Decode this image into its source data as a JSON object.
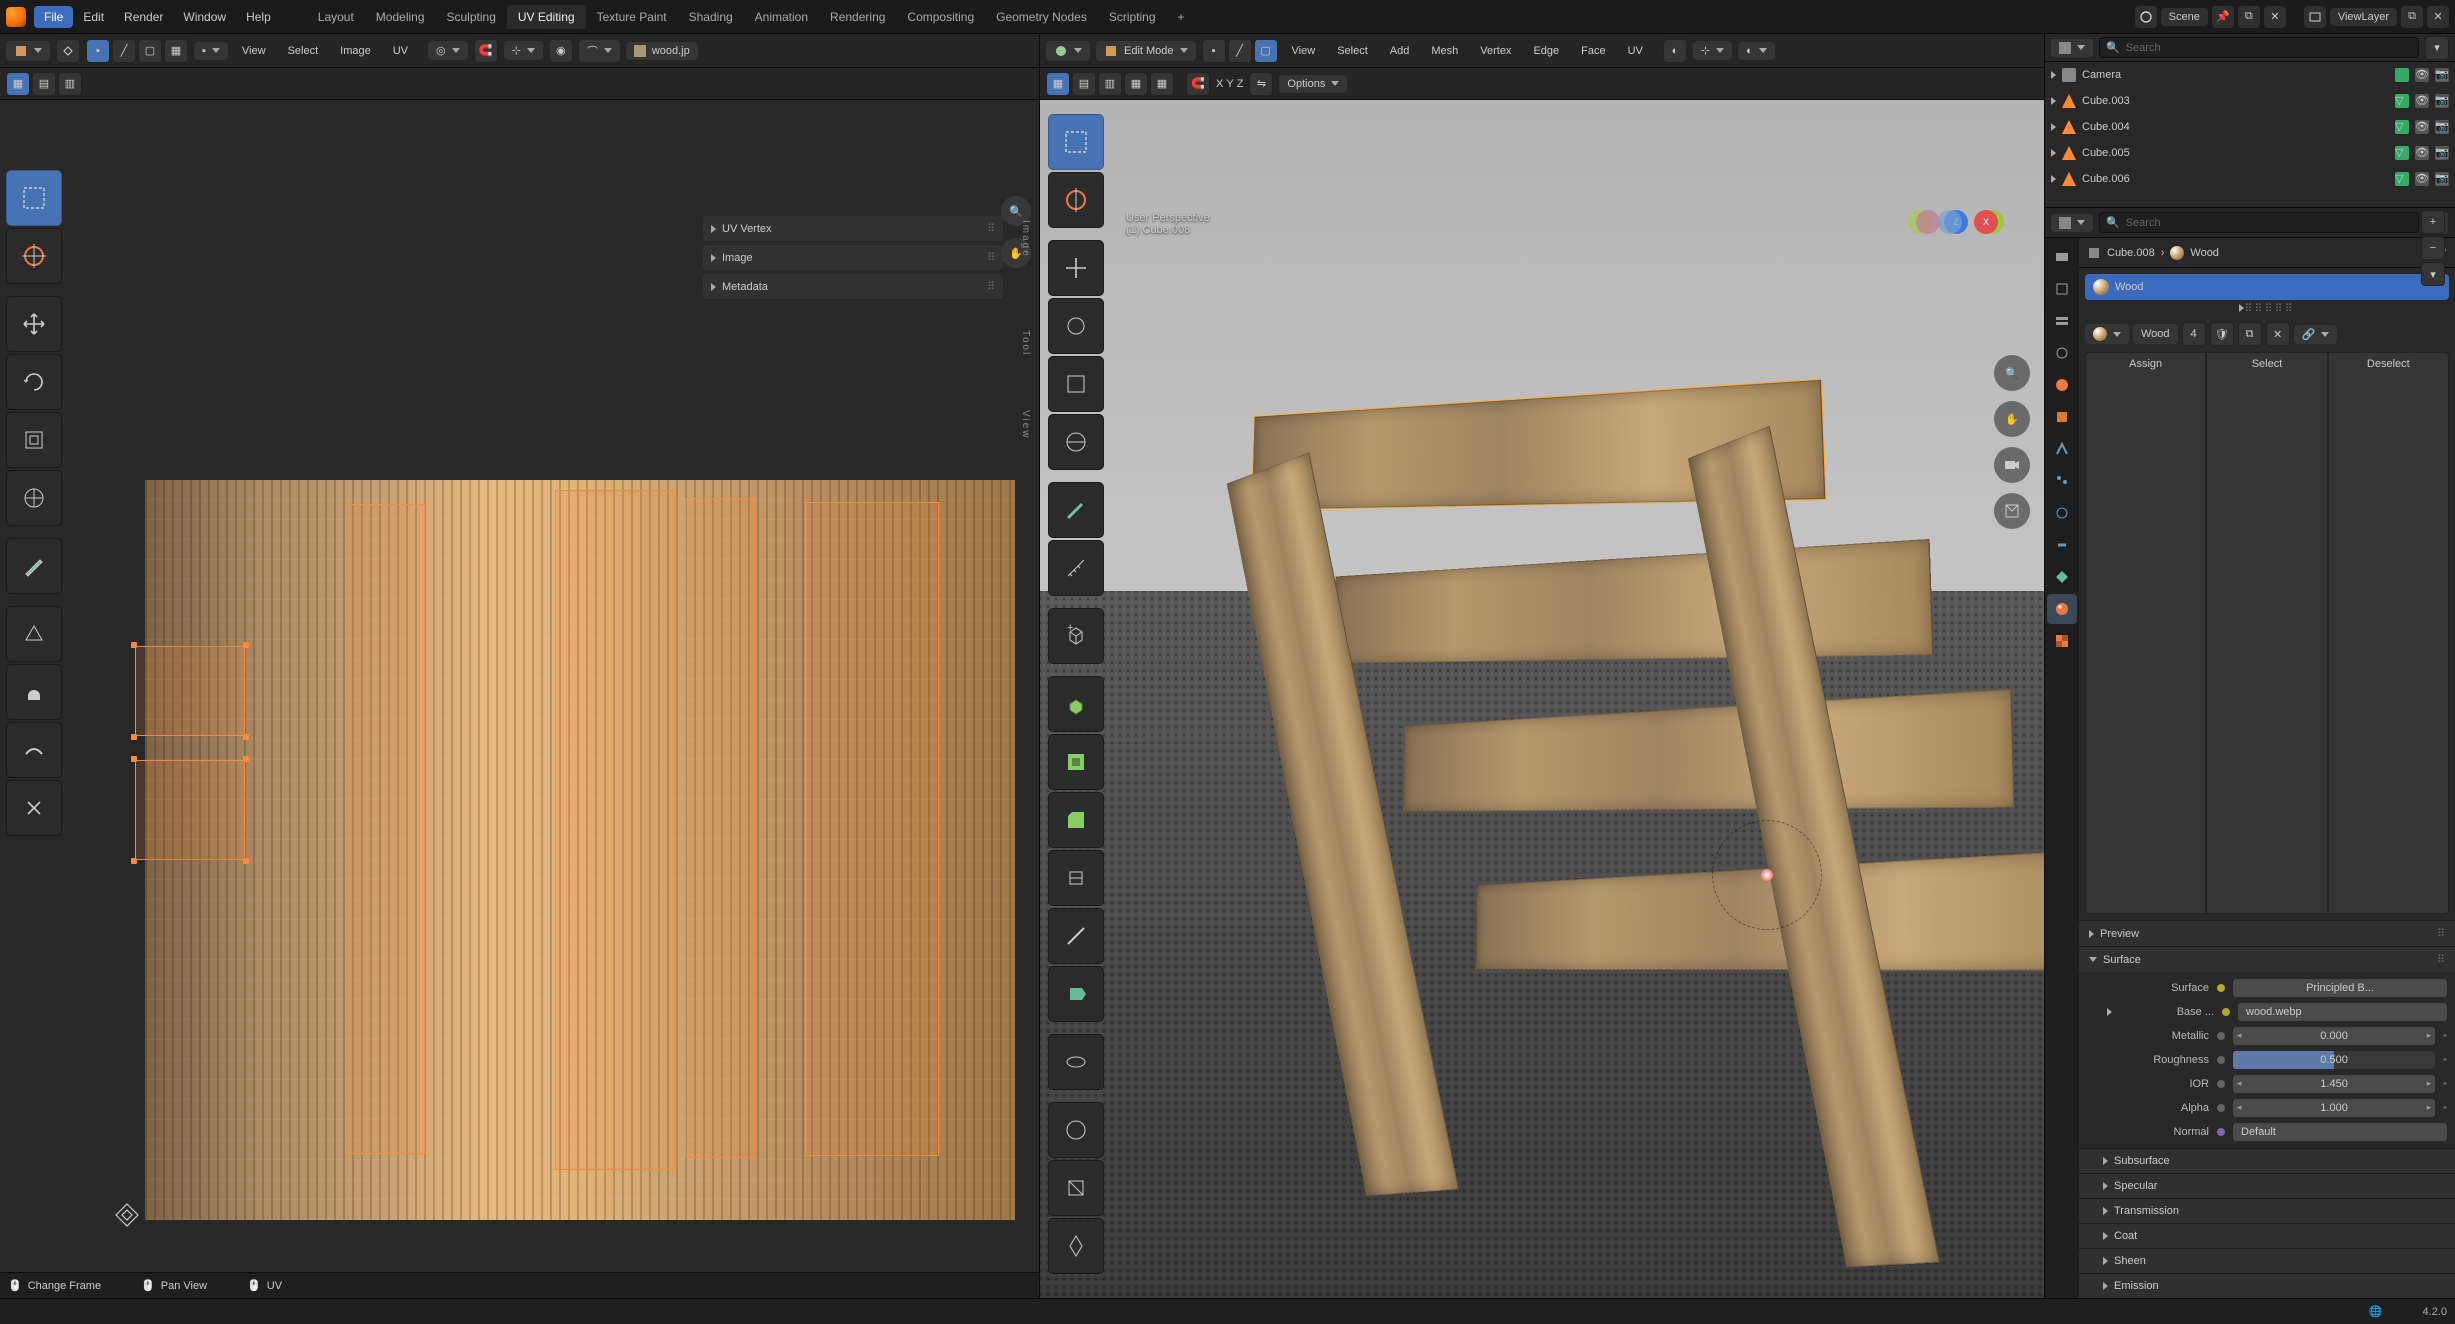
{
  "top_menu": {
    "file": "File",
    "edit": "Edit",
    "render": "Render",
    "window": "Window",
    "help": "Help"
  },
  "scene_header": {
    "scene": "Scene",
    "viewlayer": "ViewLayer"
  },
  "workspace_tabs": [
    "Layout",
    "Modeling",
    "Sculpting",
    "UV Editing",
    "Texture Paint",
    "Shading",
    "Animation",
    "Rendering",
    "Compositing",
    "Geometry Nodes",
    "Scripting"
  ],
  "active_workspace": "UV Editing",
  "uv_header": {
    "view": "View",
    "select": "Select",
    "image": "Image",
    "uv": "UV",
    "image_name": "wood.jp"
  },
  "uv_sidebar_tabs": {
    "image": "Image",
    "tool": "Tool",
    "view": "View"
  },
  "uv_side_panels": [
    "UV Vertex",
    "Image",
    "Metadata"
  ],
  "vp_header": {
    "mode": "Edit Mode",
    "view": "View",
    "select": "Select",
    "add": "Add",
    "mesh": "Mesh",
    "vertex": "Vertex",
    "edge": "Edge",
    "face": "Face",
    "uv": "UV"
  },
  "vp_overlay": {
    "axes": {
      "x": "X",
      "y": "Y",
      "z": "Z"
    },
    "options": "Options"
  },
  "vp_info": {
    "line1": "User Perspective",
    "line2": "(1) Cube.008"
  },
  "outliner": {
    "items": [
      {
        "label": "Camera",
        "type": "camera"
      },
      {
        "label": "Cube.003",
        "type": "mesh"
      },
      {
        "label": "Cube.004",
        "type": "mesh"
      },
      {
        "label": "Cube.005",
        "type": "mesh"
      },
      {
        "label": "Cube.006",
        "type": "mesh"
      }
    ]
  },
  "search_placeholder": "Search",
  "properties": {
    "crumb_obj": "Cube.008",
    "crumb_mat": "Wood",
    "material_name": "Wood",
    "material_users": "4",
    "assign": "Assign",
    "select": "Select",
    "deselect": "Deselect",
    "panels": {
      "preview": "Preview",
      "surface_panel": "Surface",
      "surface_label": "Surface",
      "surface_value": "Principled B...",
      "base_label": "Base ...",
      "base_value": "wood.webp",
      "metallic_label": "Metallic",
      "metallic_value": "0.000",
      "rough_label": "Roughness",
      "rough_value": "0.500",
      "ior_label": "IOR",
      "ior_value": "1.450",
      "alpha_label": "Alpha",
      "alpha_value": "1.000",
      "normal_label": "Normal",
      "normal_value": "Default",
      "subsurface": "Subsurface",
      "specular": "Specular",
      "transmission": "Transmission",
      "coat": "Coat",
      "sheen": "Sheen",
      "emission": "Emission"
    }
  },
  "statusbar": {
    "change_frame": "Change Frame",
    "pan_view": "Pan View",
    "uv": "UV"
  },
  "footer": {
    "version": "4.2.0"
  }
}
